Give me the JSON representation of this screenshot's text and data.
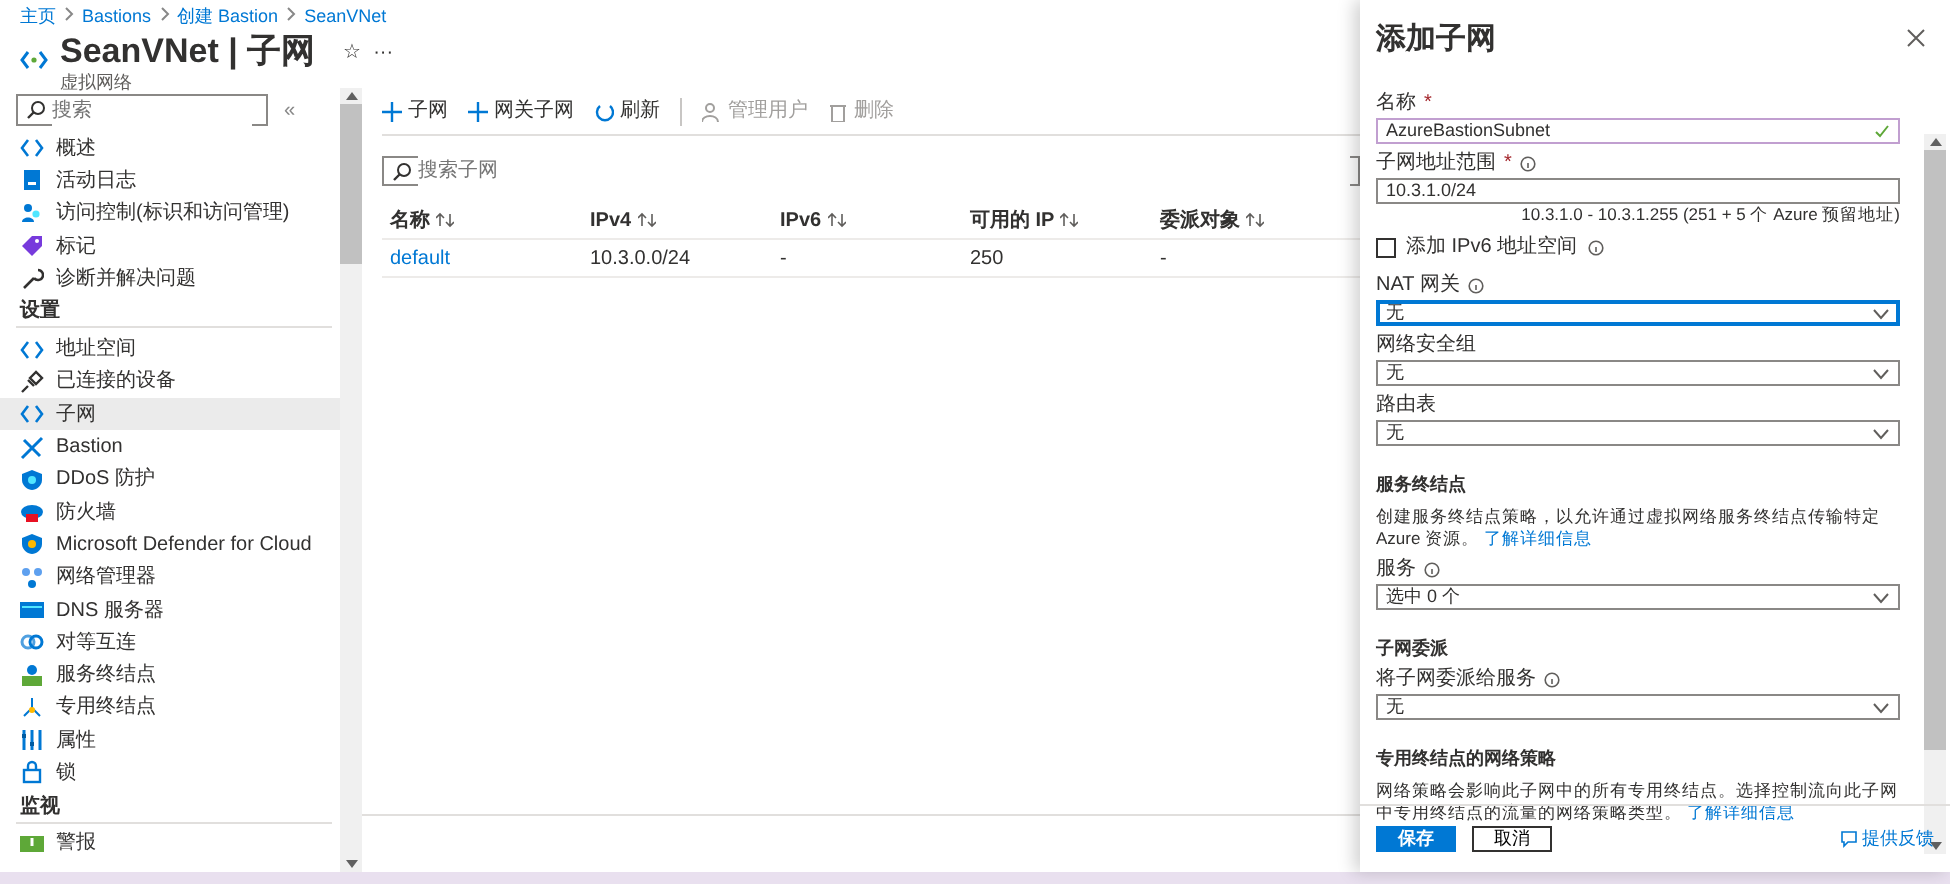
{
  "breadcrumb": [
    "主页",
    "Bastions",
    "创建 Bastion",
    "SeanVNet"
  ],
  "header": {
    "title": "SeanVNet | 子网",
    "subtitle": "虚拟网络",
    "star": "☆",
    "more": "···"
  },
  "sidebar": {
    "search_placeholder": "搜索",
    "collapse": "«",
    "items": [
      {
        "kind": "item",
        "label": "概述",
        "selected": false
      },
      {
        "kind": "item",
        "label": "活动日志",
        "selected": false
      },
      {
        "kind": "item",
        "label": "访问控制(标识和访问管理)",
        "selected": false
      },
      {
        "kind": "item",
        "label": "标记",
        "selected": false
      },
      {
        "kind": "item",
        "label": "诊断并解决问题",
        "selected": false
      },
      {
        "kind": "section",
        "label": "设置"
      },
      {
        "kind": "item",
        "label": "地址空间",
        "selected": false
      },
      {
        "kind": "item",
        "label": "已连接的设备",
        "selected": false
      },
      {
        "kind": "item",
        "label": "子网",
        "selected": true
      },
      {
        "kind": "item",
        "label": "Bastion",
        "selected": false
      },
      {
        "kind": "item",
        "label": "DDoS 防护",
        "selected": false
      },
      {
        "kind": "item",
        "label": "防火墙",
        "selected": false
      },
      {
        "kind": "item",
        "label": "Microsoft Defender for Cloud",
        "selected": false
      },
      {
        "kind": "item",
        "label": "网络管理器",
        "selected": false
      },
      {
        "kind": "item",
        "label": "DNS 服务器",
        "selected": false
      },
      {
        "kind": "item",
        "label": "对等互连",
        "selected": false
      },
      {
        "kind": "item",
        "label": "服务终结点",
        "selected": false
      },
      {
        "kind": "item",
        "label": "专用终结点",
        "selected": false
      },
      {
        "kind": "item",
        "label": "属性",
        "selected": false
      },
      {
        "kind": "item",
        "label": "锁",
        "selected": false
      },
      {
        "kind": "section",
        "label": "监视"
      },
      {
        "kind": "item",
        "label": "警报",
        "selected": false
      }
    ]
  },
  "toolbar": [
    {
      "label": "子网",
      "disabled": false
    },
    {
      "label": "网关子网",
      "disabled": false
    },
    {
      "label": "刷新",
      "disabled": false
    },
    {
      "label": "管理用户",
      "disabled": true
    },
    {
      "label": "删除",
      "disabled": true
    }
  ],
  "search": {
    "placeholder": "搜索子网"
  },
  "table": {
    "columns": [
      "名称",
      "IPv4",
      "IPv6",
      "可用的 IP",
      "委派对象"
    ],
    "rows": [
      [
        "default",
        "10.3.0.0/24",
        "-",
        "250",
        "-"
      ]
    ]
  },
  "panel": {
    "title": "添加子网",
    "fields": [
      {
        "kind": "text",
        "label": "名称",
        "required_mark": "*",
        "info": false,
        "value": "AzureBastionSubnet",
        "valid": true
      },
      {
        "kind": "text",
        "label": "子网地址范围",
        "required_mark": "*",
        "info": true,
        "value": "10.3.1.0/24",
        "valid": false,
        "hint": "10.3.1.0 - 10.3.1.255 (251 + 5 个 Azure 预留地址)"
      },
      {
        "kind": "checkbox",
        "label": "添加 IPv6 地址空间",
        "info": true,
        "checked": false
      },
      {
        "kind": "select",
        "label": "NAT 网关",
        "info": true,
        "value": "无",
        "focused": true
      },
      {
        "kind": "select",
        "label": "网络安全组",
        "info": false,
        "value": "无",
        "focused": false
      },
      {
        "kind": "select",
        "label": "路由表",
        "info": false,
        "value": "无",
        "focused": false
      },
      {
        "kind": "heading",
        "label": "服务终结点"
      },
      {
        "kind": "paragraph",
        "text": "创建服务终结点策略，以允许通过虚拟网络服务终结点传输特定 Azure 资源。",
        "link": "了解详细信息"
      },
      {
        "kind": "select",
        "label": "服务",
        "info": true,
        "value": "选中 0 个",
        "focused": false
      },
      {
        "kind": "heading",
        "label": "子网委派"
      },
      {
        "kind": "select",
        "label": "将子网委派给服务",
        "info": true,
        "value": "无",
        "focused": false
      },
      {
        "kind": "heading",
        "label": "专用终结点的网络策略"
      },
      {
        "kind": "paragraph",
        "text": "网络策略会影响此子网中的所有专用终结点。选择控制流向此子网中专用终结点的流量的网络策略类型。",
        "link": "了解详细信息"
      }
    ],
    "save": "保存",
    "cancel": "取消",
    "feedback": "提供反馈"
  }
}
